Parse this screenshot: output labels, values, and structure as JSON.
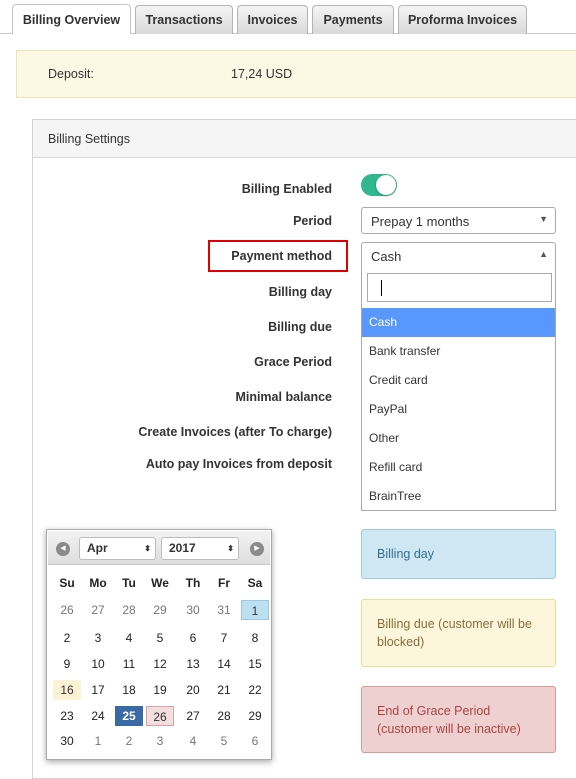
{
  "tabs": [
    {
      "label": "Billing Overview",
      "active": true
    },
    {
      "label": "Transactions",
      "active": false
    },
    {
      "label": "Invoices",
      "active": false
    },
    {
      "label": "Payments",
      "active": false
    },
    {
      "label": "Proforma Invoices",
      "active": false
    }
  ],
  "deposit": {
    "label": "Deposit:",
    "value": "17,24 USD"
  },
  "billing_settings": {
    "title": "Billing Settings",
    "fields": {
      "billing_enabled": "Billing Enabled",
      "period": "Period",
      "payment_method": "Payment method",
      "billing_day": "Billing day",
      "billing_due": "Billing due",
      "grace_period": "Grace Period",
      "minimal_balance": "Minimal balance",
      "create_invoices": "Create Invoices (after To charge)",
      "auto_pay": "Auto pay Invoices from deposit"
    },
    "billing_enabled_on": true,
    "period_value": "Prepay 1 months",
    "payment_method_value": "Cash",
    "payment_options": [
      "Cash",
      "Bank transfer",
      "Credit card",
      "PayPal",
      "Other",
      "Refill card",
      "BrainTree"
    ],
    "highlighted_option": "Cash"
  },
  "legend": {
    "billing_day": "Billing day",
    "billing_due": "Billing due (customer will be blocked)",
    "grace_end": "End of Grace Period (customer will be inactive)"
  },
  "calendar": {
    "month": "Apr",
    "year": "2017",
    "weekdays": [
      "Su",
      "Mo",
      "Tu",
      "We",
      "Th",
      "Fr",
      "Sa"
    ],
    "weeks": [
      [
        "26",
        "27",
        "28",
        "29",
        "30",
        "31",
        "1"
      ],
      [
        "2",
        "3",
        "4",
        "5",
        "6",
        "7",
        "8"
      ],
      [
        "9",
        "10",
        "11",
        "12",
        "13",
        "14",
        "15"
      ],
      [
        "16",
        "17",
        "18",
        "19",
        "20",
        "21",
        "22"
      ],
      [
        "23",
        "24",
        "25",
        "26",
        "27",
        "28",
        "29"
      ],
      [
        "30",
        "1",
        "2",
        "3",
        "4",
        "5",
        "6"
      ]
    ],
    "prev_icon": "chevron-left-icon",
    "next_icon": "chevron-right-icon"
  },
  "colors": {
    "accent_toggle": "#2fb88f",
    "highlight_option": "#5897fb",
    "today": "#3a6aa6",
    "billing_day_bg": "#cfe6f3",
    "billing_due_bg": "#fcf7dc",
    "grace_end_bg": "#efd0d0",
    "annotation_box": "#e00000"
  }
}
